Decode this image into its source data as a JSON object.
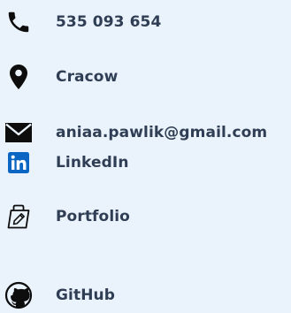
{
  "contacts": {
    "phone": {
      "label": "535 093 654",
      "icon": "phone-icon"
    },
    "city": {
      "label": "Cracow",
      "icon": "map-pin-icon"
    },
    "email": {
      "label": "aniaa.pawlik@gmail.com",
      "icon": "envelope-icon"
    },
    "linkedin": {
      "label": "LinkedIn",
      "icon": "linkedin-icon"
    },
    "portfolio": {
      "label": "Portfolio",
      "icon": "portfolio-icon"
    },
    "github": {
      "label": "GitHub",
      "icon": "github-icon"
    }
  },
  "colors": {
    "background": "#eaf3fb",
    "text": "#2f3e54",
    "icon_dark": "#0d0d0d",
    "linkedin_blue": "#0a66c2"
  }
}
